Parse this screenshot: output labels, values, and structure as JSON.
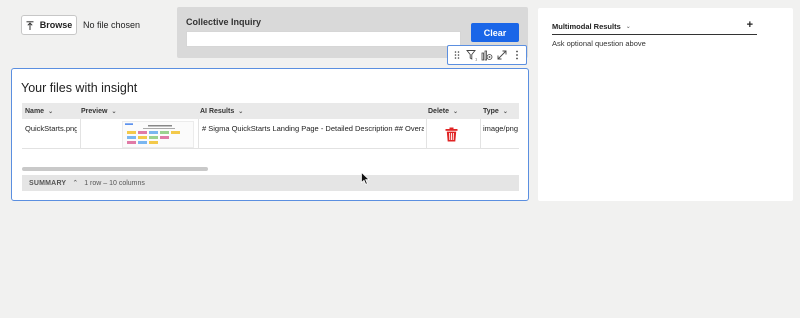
{
  "upload": {
    "browse_label": "Browse",
    "icon": "upload-icon",
    "status_text": "No file chosen"
  },
  "inquiry": {
    "title": "Collective Inquiry",
    "input_value": "",
    "clear_label": "Clear"
  },
  "toolbar": {
    "icons": [
      "drag-handle-icon",
      "filter-icon",
      "chart-settings-icon",
      "expand-icon",
      "more-vertical-icon"
    ]
  },
  "files_panel": {
    "title": "Your files with insight",
    "columns": {
      "name": "Name",
      "preview": "Preview",
      "ai_results": "AI Results",
      "delete": "Delete",
      "type": "Type"
    },
    "rows": [
      {
        "name": "QuickStarts.png",
        "ai_results": "# Sigma QuickStarts Landing Page - Detailed Description  ## Overall ...",
        "type": "image/png"
      }
    ],
    "summary_label": "SUMMARY",
    "summary_count": "1 row – 10 columns"
  },
  "results": {
    "title": "Multimodal Results",
    "add_label": "+",
    "hint": "Ask optional question above"
  },
  "colors": {
    "accent": "#1a66e8",
    "delete": "#e02424",
    "panel_border": "#5b8fe0"
  }
}
